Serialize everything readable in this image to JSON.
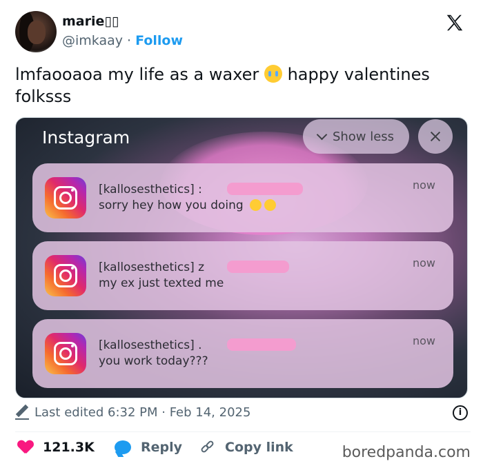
{
  "user": {
    "name": "marie▯▯",
    "handle": "@imkaay",
    "separator": "·",
    "follow_label": "Follow"
  },
  "tweet": {
    "text_before_emoji": "lmfaooaoa my life as a waxer",
    "text_after_emoji": " happy valentines folksss",
    "emoji_icon": "loudly-crying-face-icon"
  },
  "screenshot": {
    "app_title": "Instagram",
    "show_less_label": "Show less",
    "notifications": [
      {
        "sender": "[kallosesthetics] :",
        "message": "sorry hey how you doing",
        "time": "now"
      },
      {
        "sender": "[kallosesthetics] z",
        "message": "my ex just texted me",
        "time": "now"
      },
      {
        "sender": "[kallosesthetics] .",
        "message": "you work today???",
        "time": "now"
      }
    ]
  },
  "meta": {
    "edited_text": "Last edited 6:32 PM · Feb 14, 2025",
    "info_glyph": "i"
  },
  "actions": {
    "likes_count": "121.3K",
    "reply_label": "Reply",
    "copy_link_label": "Copy link"
  },
  "watermark": "boredpanda.com",
  "colors": {
    "follow": "#1d9bf0",
    "like": "#f91880",
    "reply": "#1d9bf0",
    "secondary_text": "#536471"
  }
}
